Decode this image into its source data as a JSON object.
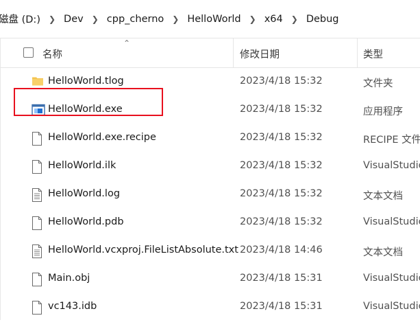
{
  "breadcrumb": [
    "磁盘 (D:)",
    "Dev",
    "cpp_cherno",
    "HelloWorld",
    "x64",
    "Debug"
  ],
  "columns": {
    "name": "名称",
    "date": "修改日期",
    "type": "类型"
  },
  "files": [
    {
      "name": "HelloWorld.tlog",
      "date": "2023/4/18 15:32",
      "type": "文件夹",
      "icon": "folder-icon"
    },
    {
      "name": "HelloWorld.exe",
      "date": "2023/4/18 15:32",
      "type": "应用程序",
      "icon": "exe-icon"
    },
    {
      "name": "HelloWorld.exe.recipe",
      "date": "2023/4/18 15:32",
      "type": "RECIPE 文件",
      "icon": "file-icon"
    },
    {
      "name": "HelloWorld.ilk",
      "date": "2023/4/18 15:32",
      "type": "VisualStudio",
      "icon": "file-icon"
    },
    {
      "name": "HelloWorld.log",
      "date": "2023/4/18 15:32",
      "type": "文本文档",
      "icon": "text-file-icon"
    },
    {
      "name": "HelloWorld.pdb",
      "date": "2023/4/18 15:32",
      "type": "VisualStudio",
      "icon": "file-icon"
    },
    {
      "name": "HelloWorld.vcxproj.FileListAbsolute.txt",
      "date": "2023/4/18 14:46",
      "type": "文本文档",
      "icon": "text-file-icon"
    },
    {
      "name": "Main.obj",
      "date": "2023/4/18 15:31",
      "type": "VisualStudio",
      "icon": "file-icon"
    },
    {
      "name": "vc143.idb",
      "date": "2023/4/18 15:31",
      "type": "VisualStudio",
      "icon": "file-icon"
    }
  ],
  "colors": {
    "highlight": "#e8101e",
    "folder": "#f4c44e",
    "exe_blue": "#1f6fd1"
  }
}
